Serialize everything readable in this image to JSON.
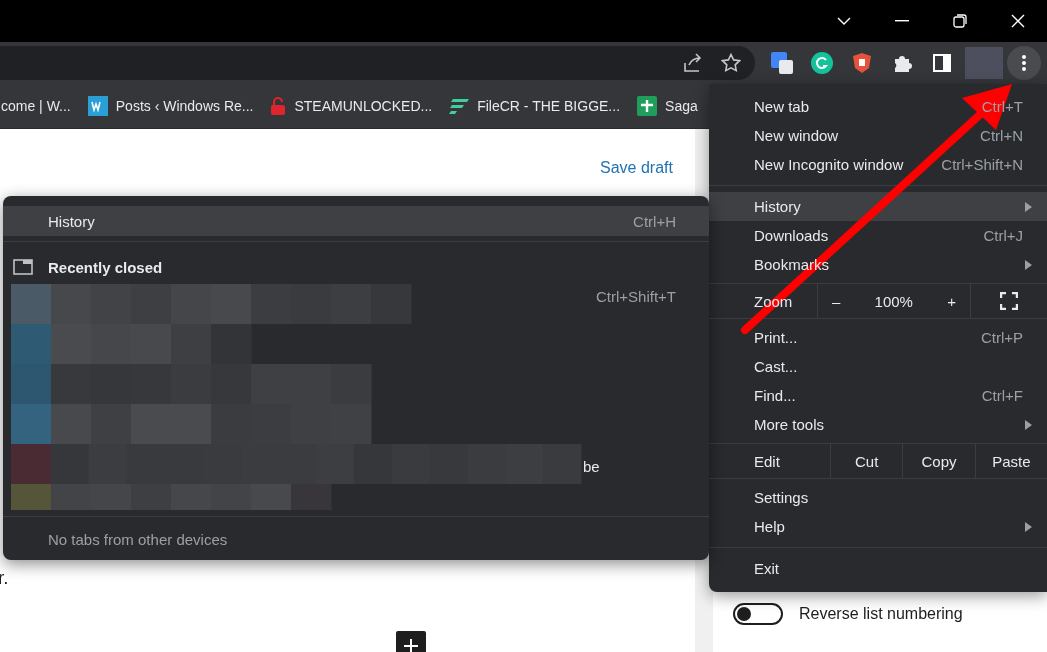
{
  "bookmarks": [
    {
      "label": "come | W..."
    },
    {
      "label": "Posts ‹ Windows Re..."
    },
    {
      "label": "STEAMUNLOCKED..."
    },
    {
      "label": "FileCR - THE BIGGE..."
    },
    {
      "label": "Saga"
    }
  ],
  "page": {
    "save_link": "Save draft",
    "body_fragment": "r.",
    "toggle": {
      "label": "Reverse list numbering",
      "on": false
    }
  },
  "main_menu": {
    "items": [
      {
        "kind": "item",
        "label": "New tab",
        "shortcut": "Ctrl+T",
        "submenu": false,
        "selected": false
      },
      {
        "kind": "item",
        "label": "New window",
        "shortcut": "Ctrl+N",
        "submenu": false,
        "selected": false
      },
      {
        "kind": "item",
        "label": "New Incognito window",
        "shortcut": "Ctrl+Shift+N",
        "submenu": false,
        "selected": false
      },
      {
        "kind": "separator"
      },
      {
        "kind": "item",
        "label": "History",
        "submenu": true,
        "selected": true
      },
      {
        "kind": "item",
        "label": "Downloads",
        "shortcut": "Ctrl+J",
        "submenu": false,
        "selected": false
      },
      {
        "kind": "item",
        "label": "Bookmarks",
        "submenu": true,
        "selected": false
      },
      {
        "kind": "zoom",
        "label": "Zoom",
        "minus": "–",
        "value": "100%",
        "plus": "+"
      },
      {
        "kind": "item",
        "label": "Print...",
        "shortcut": "Ctrl+P",
        "submenu": false,
        "selected": false
      },
      {
        "kind": "item",
        "label": "Cast...",
        "submenu": false,
        "selected": false
      },
      {
        "kind": "item",
        "label": "Find...",
        "shortcut": "Ctrl+F",
        "submenu": false,
        "selected": false
      },
      {
        "kind": "item",
        "label": "More tools",
        "submenu": true,
        "selected": false
      },
      {
        "kind": "edit",
        "label": "Edit",
        "actions": [
          "Cut",
          "Copy",
          "Paste"
        ]
      },
      {
        "kind": "item",
        "label": "Settings",
        "submenu": false,
        "selected": false
      },
      {
        "kind": "item",
        "label": "Help",
        "submenu": true,
        "selected": false
      },
      {
        "kind": "separator"
      },
      {
        "kind": "item",
        "label": "Exit",
        "submenu": false,
        "selected": false
      }
    ]
  },
  "history_menu": {
    "history": {
      "label": "History",
      "shortcut": "Ctrl+H",
      "selected": true
    },
    "recently_closed": {
      "label": "Recently closed",
      "shortcut": "Ctrl+Shift+T",
      "visible_fragment": "be"
    },
    "other_devices": "No tabs from other devices"
  }
}
